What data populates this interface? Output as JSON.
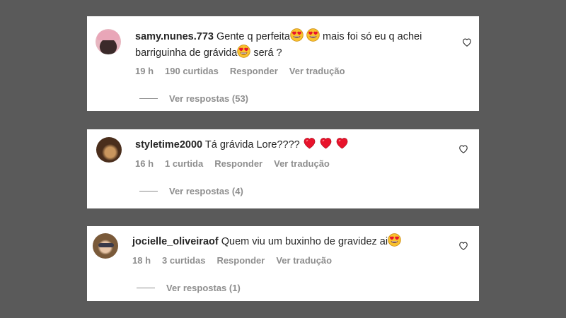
{
  "comments": [
    {
      "username": "samy.nunes.773",
      "text_part1": "Gente q perfeita",
      "text_part2": " mais foi só eu q achei",
      "text_line2": "barriguinha de grávida",
      "text_line2_end": " será ?",
      "emoji_icon": "heart-eyes-emoji",
      "time": "19 h",
      "likes": "190 curtidas",
      "reply_label": "Responder",
      "translate_label": "Ver tradução",
      "view_replies": "Ver respostas (53)"
    },
    {
      "username": "styletime2000",
      "text_part1": "Tá grávida Lore????",
      "emoji_icon": "red-heart-emoji",
      "time": "16 h",
      "likes": "1 curtida",
      "reply_label": "Responder",
      "translate_label": "Ver tradução",
      "view_replies": "Ver respostas (4)"
    },
    {
      "username": "jocielle_oliveiraof",
      "text_part1": "Quem viu um buxinho de gravidez ai",
      "emoji_icon": "heart-eyes-emoji",
      "time": "18 h",
      "likes": "3 curtidas",
      "reply_label": "Responder",
      "translate_label": "Ver tradução",
      "view_replies": "Ver respostas (1)"
    }
  ],
  "colors": {
    "background": "#5a5a5a",
    "card": "#ffffff",
    "text": "#262626",
    "muted": "#8e8e8e",
    "heart_red": "#e8132b",
    "emoji_yellow": "#f9c12e"
  },
  "icons": {
    "like": "heart-outline-icon"
  }
}
